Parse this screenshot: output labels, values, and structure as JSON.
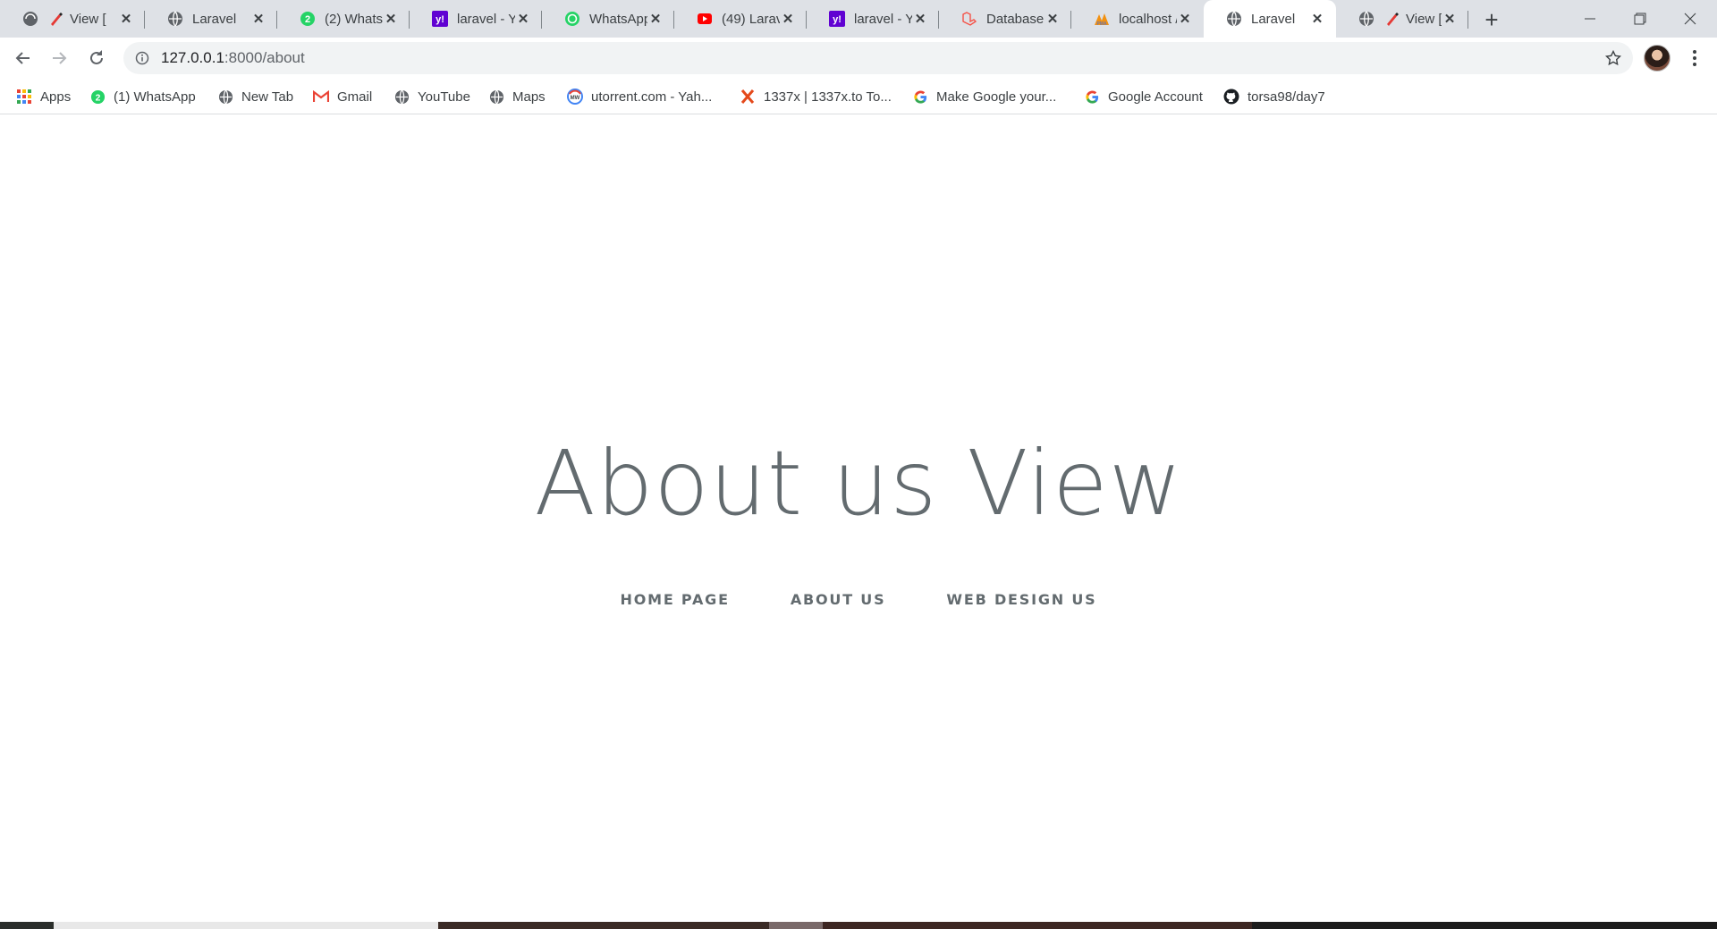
{
  "tabs": [
    {
      "title": "View [",
      "icon": "pencil-icon"
    },
    {
      "title": "Laravel",
      "icon": "globe-icon"
    },
    {
      "title": "(2) Whats/",
      "icon": "whatsapp-badge-icon"
    },
    {
      "title": "laravel - Y",
      "icon": "yahoo-icon"
    },
    {
      "title": "WhatsApp",
      "icon": "whatsapp-icon"
    },
    {
      "title": "(49) Larav",
      "icon": "youtube-icon"
    },
    {
      "title": "laravel - Y",
      "icon": "yahoo-icon"
    },
    {
      "title": "Database",
      "icon": "laravel-icon"
    },
    {
      "title": "localhost /",
      "icon": "phpmyadmin-icon"
    },
    {
      "title": "Laravel",
      "icon": "globe-icon",
      "active": true
    },
    {
      "title": "View [",
      "icon": "pencil-icon"
    }
  ],
  "tab_close_glyph": "✕",
  "new_tab_glyph": "+",
  "address": {
    "host": "127.0.0.1",
    "path": ":8000/about"
  },
  "bookmarks": [
    {
      "label": "Apps",
      "icon": "apps-grid-icon"
    },
    {
      "label": "(1) WhatsApp",
      "icon": "whatsapp-badge-icon"
    },
    {
      "label": "New Tab",
      "icon": "globe-icon"
    },
    {
      "label": "Gmail",
      "icon": "gmail-icon"
    },
    {
      "label": "YouTube",
      "icon": "globe-icon"
    },
    {
      "label": "Maps",
      "icon": "globe-icon"
    },
    {
      "label": "utorrent.com - Yah...",
      "icon": "mw-icon"
    },
    {
      "label": "1337x | 1337x.to To...",
      "icon": "x-logo-icon"
    },
    {
      "label": "Make Google your...",
      "icon": "google-icon"
    },
    {
      "label": "Google Account",
      "icon": "google-icon"
    },
    {
      "label": "torsa98/day7",
      "icon": "github-icon"
    }
  ],
  "page": {
    "title": "About us View",
    "links": [
      "HOME PAGE",
      "ABOUT US",
      "WEB DESIGN US"
    ]
  },
  "colors": {
    "text": "#636b6f",
    "tabstrip": "#dee1e6",
    "omnibox": "#f1f3f4"
  }
}
